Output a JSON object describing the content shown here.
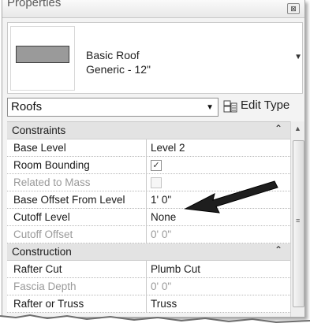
{
  "window": {
    "title": "Properties",
    "close_glyph": "⊠"
  },
  "type_selector": {
    "line1": "Basic Roof",
    "line2": "Generic - 12\"",
    "swatch_color": "#9a9a9a"
  },
  "family_select": {
    "value": "Roofs",
    "edit_type_label": "Edit Type"
  },
  "groups": [
    {
      "label": "Constraints",
      "rows": [
        {
          "name": "Base Level",
          "value": "Level 2"
        },
        {
          "name": "Room Bounding",
          "value": "",
          "checkbox": true,
          "checked": true
        },
        {
          "name": "Related to Mass",
          "value": "",
          "checkbox": true,
          "checked": false
        },
        {
          "name": "Base Offset From Level",
          "value": "1'  0\""
        },
        {
          "name": "Cutoff Level",
          "value": "None"
        },
        {
          "name": "Cutoff Offset",
          "value": "0'  0\""
        }
      ]
    },
    {
      "label": "Construction",
      "rows": [
        {
          "name": "Rafter Cut",
          "value": "Plumb Cut"
        },
        {
          "name": "Fascia Depth",
          "value": "0'  0\""
        },
        {
          "name": "Rafter or Truss",
          "value": "Truss"
        }
      ]
    }
  ],
  "glyphs": {
    "collapse": "⌃",
    "checkmark": "✓",
    "dropdown": "▼",
    "scroll_up": "▲",
    "grip": "≡"
  }
}
